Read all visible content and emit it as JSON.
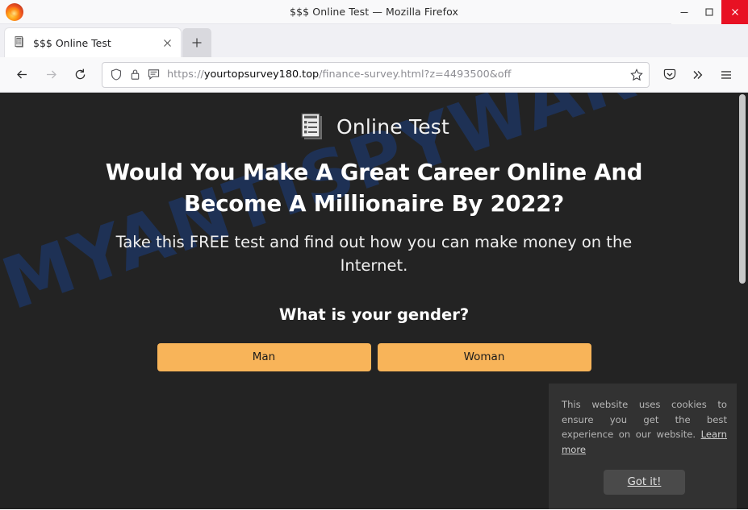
{
  "window": {
    "title": "$$$ Online Test — Mozilla Firefox",
    "minimize_label": "Minimize",
    "maximize_label": "Maximize",
    "close_label": "Close"
  },
  "tabs": {
    "items": [
      {
        "title": "$$$ Online Test",
        "favicon": "document-checklist-icon",
        "close_label": "Close tab"
      }
    ],
    "new_tab_label": "+"
  },
  "toolbar": {
    "back_label": "Back",
    "forward_label": "Forward",
    "reload_label": "Reload",
    "pocket_label": "Save to Pocket",
    "overflow_label": "More tools",
    "menu_label": "Open application menu"
  },
  "urlbar": {
    "protocol": "https://",
    "host": "yourtopsurvey180.top",
    "path": "/finance-survey.html?z=4493500&off",
    "full_url": "https://yourtopsurvey180.top/finance-survey.html?z=4493500&off",
    "shield_icon": "shield-icon",
    "lock_icon": "lock-icon",
    "reader_icon": "reader-view-icon",
    "bookmark_icon": "star-icon"
  },
  "page": {
    "brand": {
      "icon": "document-checklist-icon",
      "name": "Online Test"
    },
    "headline": "Would You Make A Great Career Online And Become A Millionaire By 2022?",
    "subhead": "Take this FREE test and find out how you can make money on the Internet.",
    "question": "What is your gender?",
    "answers": [
      {
        "label": "Man"
      },
      {
        "label": "Woman"
      }
    ],
    "watermark": "MYANTISPYWARE.COM",
    "background_color": "#232323",
    "accent_color": "#f8b459",
    "watermark_color": "#1b3b74"
  },
  "cookie_banner": {
    "message": "This website uses cookies to ensure you get the best experience on our website.",
    "learn_more_label": "Learn more",
    "accept_label": "Got it!"
  }
}
